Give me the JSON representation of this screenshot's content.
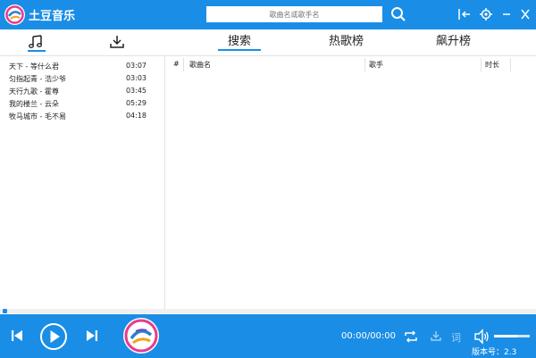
{
  "titlebar": {
    "title": "土豆音乐",
    "search_placeholder": "歌曲名或歌手名"
  },
  "side_tabs": [
    "music-note-icon",
    "download-icon"
  ],
  "main_tabs": [
    {
      "label": "搜索",
      "active": true
    },
    {
      "label": "热歌榜",
      "active": false
    },
    {
      "label": "飙升榜",
      "active": false
    }
  ],
  "playlist": [
    {
      "name": "天下 - 等什么君",
      "time": "03:07"
    },
    {
      "name": "匀指起青 - 浩少爷",
      "time": "03:03"
    },
    {
      "name": "天行九歌 - 霍尊",
      "time": "03:45"
    },
    {
      "name": "我的楼兰 - 云朵",
      "time": "05:29"
    },
    {
      "name": "牧马城市 - 毛不易",
      "time": "04:18"
    }
  ],
  "table": {
    "columns": [
      "#",
      "歌曲名",
      "歌手",
      "时长"
    ]
  },
  "player": {
    "time": "00:00/00:00",
    "lyrics_label": "词",
    "volume": 0.65,
    "progress": 0.0
  },
  "version": "版本号：2.3",
  "colors": {
    "accent": "#1a8ee6"
  }
}
